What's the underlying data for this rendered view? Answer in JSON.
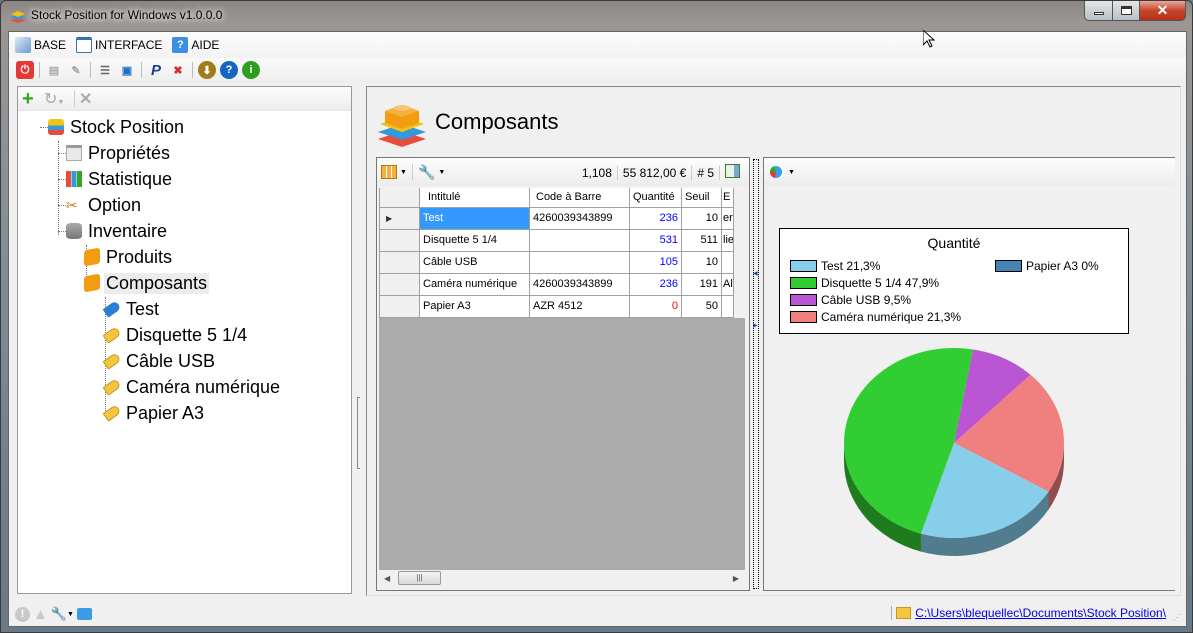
{
  "window": {
    "title": "Stock Position for Windows v1.0.0.0",
    "controls": {
      "minimize": "minimize",
      "maximize": "maximize",
      "close": "close"
    }
  },
  "menu": [
    {
      "label": "BASE",
      "icon": "database-file-icon"
    },
    {
      "label": "INTERFACE",
      "icon": "window-icon"
    },
    {
      "label": "AIDE",
      "icon": "help-icon"
    }
  ],
  "toolbar": [
    {
      "icon": "power-icon",
      "color": "#e53935",
      "glyph": "⏻"
    },
    {
      "icon": "add-db-icon",
      "color": "#bdbdbd",
      "glyph": "▤"
    },
    {
      "icon": "edit-db-icon",
      "color": "#bdbdbd",
      "glyph": "✎"
    },
    {
      "icon": "database-icon",
      "color": "#777777",
      "glyph": "☰"
    },
    {
      "icon": "save-icon",
      "color": "#1e6fc5",
      "glyph": "▣"
    },
    {
      "icon": "paypal-icon",
      "color": "#1a3d8f",
      "glyph": "P"
    },
    {
      "icon": "close-comment-icon",
      "color": "#d32f2f",
      "glyph": "✖"
    },
    {
      "icon": "download-icon",
      "color": "#a07d18",
      "glyph": "⬇"
    },
    {
      "icon": "help-icon",
      "color": "#1565c0",
      "glyph": "?"
    },
    {
      "icon": "info-icon",
      "color": "#2e9e1e",
      "glyph": "i"
    }
  ],
  "tree_toolbar": {
    "add": "+",
    "refresh": "↻",
    "delete": "✕"
  },
  "tree": [
    {
      "label": "Stock Position",
      "icon": "layers-icon",
      "level": 0
    },
    {
      "label": "Propriétés",
      "icon": "properties-icon",
      "level": 1
    },
    {
      "label": "Statistique",
      "icon": "bar-chart-icon",
      "level": 1
    },
    {
      "label": "Option",
      "icon": "tools-icon",
      "level": 1
    },
    {
      "label": "Inventaire",
      "icon": "database-icon",
      "level": 1
    },
    {
      "label": "Produits",
      "icon": "brick-icon",
      "level": 2
    },
    {
      "label": "Composants",
      "icon": "brick-icon",
      "level": 2,
      "selected": true
    },
    {
      "label": "Test",
      "icon": "blue-tag-icon",
      "level": 3
    },
    {
      "label": "Disquette 5 1/4",
      "icon": "yellow-tag-icon",
      "level": 3
    },
    {
      "label": "Câble USB",
      "icon": "yellow-tag-icon",
      "level": 3
    },
    {
      "label": "Caméra numérique",
      "icon": "yellow-tag-icon",
      "level": 3
    },
    {
      "label": "Papier A3",
      "icon": "yellow-tag-icon",
      "level": 3
    }
  ],
  "page": {
    "title": "Composants"
  },
  "grid": {
    "stats": {
      "total_qty": "1,108",
      "total_value": "55 812,00 €",
      "count": "# 5"
    },
    "columns": [
      "Intitulé",
      "Code à Barre",
      "Quantité",
      "Seuil",
      "E"
    ],
    "rows": [
      {
        "name": "Test",
        "barcode": "4260039343899",
        "qty": "236",
        "qty_color": "#0000ff",
        "threshold": "10",
        "extra": "er",
        "selected": true
      },
      {
        "name": "Disquette 5 1/4",
        "barcode": "",
        "qty": "531",
        "qty_color": "#0000ff",
        "threshold": "511",
        "extra": "lie"
      },
      {
        "name": "Câble USB",
        "barcode": "",
        "qty": "105",
        "qty_color": "#0000ff",
        "threshold": "10",
        "extra": ""
      },
      {
        "name": "Caméra numérique",
        "barcode": "4260039343899",
        "qty": "236",
        "qty_color": "#0000ff",
        "threshold": "191",
        "extra": "Al"
      },
      {
        "name": "Papier A3",
        "barcode": "AZR 4512",
        "qty": "0",
        "qty_color": "#ff0000",
        "threshold": "50",
        "extra": ""
      }
    ]
  },
  "chart_data": {
    "type": "pie",
    "title": "Quantité",
    "legend_position": "top",
    "categories": [
      "Test",
      "Disquette 5 1/4",
      "Câble USB",
      "Caméra numérique",
      "Papier A3"
    ],
    "values": [
      236,
      531,
      105,
      236,
      0
    ],
    "percent_labels": [
      "Test 21,3%",
      "Disquette 5 1/4 47,9%",
      "Câble USB 9,5%",
      "Caméra numérique 21,3%",
      "Papier A3 0%"
    ],
    "colors": [
      "#87ceeb",
      "#32cd32",
      "#ba55d3",
      "#f08080",
      "#4682b4"
    ],
    "style": "3d"
  },
  "status": {
    "path": "C:\\Users\\blequellec\\Documents\\Stock Position\\"
  }
}
